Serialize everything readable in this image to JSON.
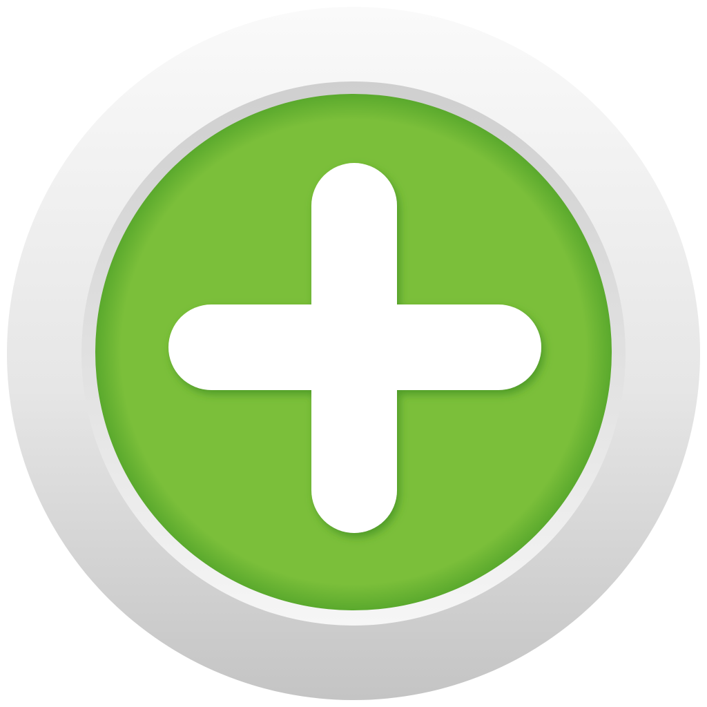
{
  "button": {
    "icon": "plus-icon",
    "colors": {
      "bezel_top": "#fafafa",
      "bezel_bottom": "#c4c4c4",
      "groove_top": "#cfcfcf",
      "groove_bottom": "#f6f6f6",
      "face": "#7bbf3a",
      "face_edge": "#5aa92d",
      "plus_fill": "#ffffff",
      "plus_shadow": "#3f8f22"
    }
  }
}
